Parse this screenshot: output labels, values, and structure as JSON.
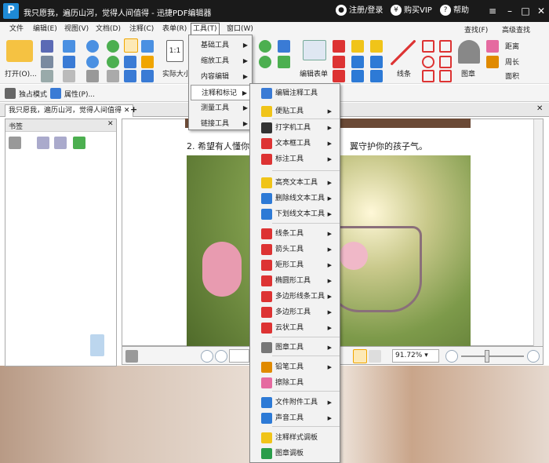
{
  "title": "我只愿我，遍历山河，觉得人间值得 - 迅捷PDF编辑器",
  "header": {
    "logo": "P",
    "login": "注册/登录",
    "vip": "购买VIP",
    "help": "帮助"
  },
  "menu": [
    "文件",
    "编辑(E)",
    "视图(V)",
    "文档(D)",
    "注释(C)",
    "表单(R)",
    "工具(T)",
    "窗口(W)"
  ],
  "ribbon": {
    "open": "打开(O)...",
    "actual_size": "实际大小",
    "edit_form": "编辑表单",
    "line": "线条",
    "stamp": "图章",
    "find": "查找(F)",
    "adv_find": "高级查找",
    "distance": "距离",
    "perimeter": "周长",
    "area": "面积",
    "page_num": "1:1"
  },
  "qbar": {
    "mode": "独占模式",
    "props": "属性(P)..."
  },
  "doc_tab": "我只愿我，遍历山河，觉得人间值得",
  "bookmark_title": "书签",
  "doc": {
    "text_left": "2. 希望有人懂你",
    "text_right": "翼守护你的孩子气。"
  },
  "status": {
    "zoom": "91.72%"
  },
  "tools_menu": [
    "基础工具",
    "缩放工具",
    "内容编辑",
    "注释和标记",
    "测量工具",
    "链接工具"
  ],
  "annot_menu": [
    {
      "label": "编辑注释工具",
      "icon": "edit-annotation-icon",
      "color": "#3a7bd5",
      "arrow": ""
    },
    {
      "label": "便贴工具",
      "icon": "sticky-note-icon",
      "color": "#f0c419",
      "arrow": "▶"
    },
    {
      "label": "打字机工具",
      "icon": "typewriter-icon",
      "color": "#333333",
      "arrow": "▶"
    },
    {
      "label": "文本框工具",
      "icon": "textbox-icon",
      "color": "#d33",
      "arrow": "▶"
    },
    {
      "label": "标注工具",
      "icon": "callout-icon",
      "color": "#d33",
      "arrow": "▶"
    },
    {
      "label": "高亮文本工具",
      "icon": "highlight-icon",
      "color": "#f0c419",
      "arrow": "▶"
    },
    {
      "label": "删除线文本工具",
      "icon": "strikeout-icon",
      "color": "#2d7ad6",
      "arrow": "▶"
    },
    {
      "label": "下划线文本工具",
      "icon": "underline-icon",
      "color": "#2d7ad6",
      "arrow": "▶"
    },
    {
      "label": "线条工具",
      "icon": "line-icon",
      "color": "#d33",
      "arrow": "▶"
    },
    {
      "label": "箭头工具",
      "icon": "arrow-icon",
      "color": "#d33",
      "arrow": "▶"
    },
    {
      "label": "矩形工具",
      "icon": "rectangle-icon",
      "color": "#d33",
      "arrow": "▶"
    },
    {
      "label": "椭圆形工具",
      "icon": "ellipse-icon",
      "color": "#d33",
      "arrow": "▶"
    },
    {
      "label": "多边形线条工具",
      "icon": "polyline-icon",
      "color": "#d33",
      "arrow": "▶"
    },
    {
      "label": "多边形工具",
      "icon": "polygon-icon",
      "color": "#d33",
      "arrow": "▶"
    },
    {
      "label": "云状工具",
      "icon": "cloud-icon",
      "color": "#d33",
      "arrow": "▶"
    },
    {
      "label": "图章工具",
      "icon": "stamp-icon",
      "color": "#777777",
      "arrow": "▶"
    },
    {
      "label": "铅笔工具",
      "icon": "pencil-icon",
      "color": "#e08a00",
      "arrow": "▶"
    },
    {
      "label": "擦除工具",
      "icon": "eraser-icon",
      "color": "#e56aa0",
      "arrow": ""
    },
    {
      "label": "文件附件工具",
      "icon": "attachment-icon",
      "color": "#2d7ad6",
      "arrow": "▶"
    },
    {
      "label": "声音工具",
      "icon": "sound-icon",
      "color": "#2d7ad6",
      "arrow": "▶"
    },
    {
      "label": "注释样式调板",
      "icon": "style-palette-icon",
      "color": "#f0c419",
      "arrow": ""
    },
    {
      "label": "图章调板",
      "icon": "stamp-palette-icon",
      "color": "#2a9d4a",
      "arrow": ""
    }
  ]
}
